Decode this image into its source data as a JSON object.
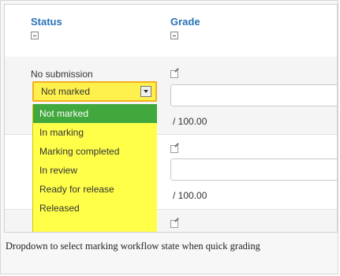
{
  "columns": {
    "status": "Status",
    "grade": "Grade"
  },
  "rows": [
    {
      "status": "No submission",
      "grade_max": "/ 100.00"
    },
    {
      "grade_max": "/ 100.00"
    }
  ],
  "workflow_select": {
    "selected": "Not marked",
    "options": [
      "Not marked",
      "In marking",
      "Marking completed",
      "In review",
      "Ready for release",
      "Released"
    ]
  },
  "caption": "Dropdown to select marking workflow state when quick grading",
  "colors": {
    "column_header": "#2a73b8",
    "highlight_yellow": "#ffff4a",
    "selected_option": "#41a83d",
    "select_border": "#f2b01e"
  },
  "icons": {
    "collapse": "collapse-icon",
    "edit": "edit-icon",
    "dropdown": "chevron-down-icon"
  }
}
